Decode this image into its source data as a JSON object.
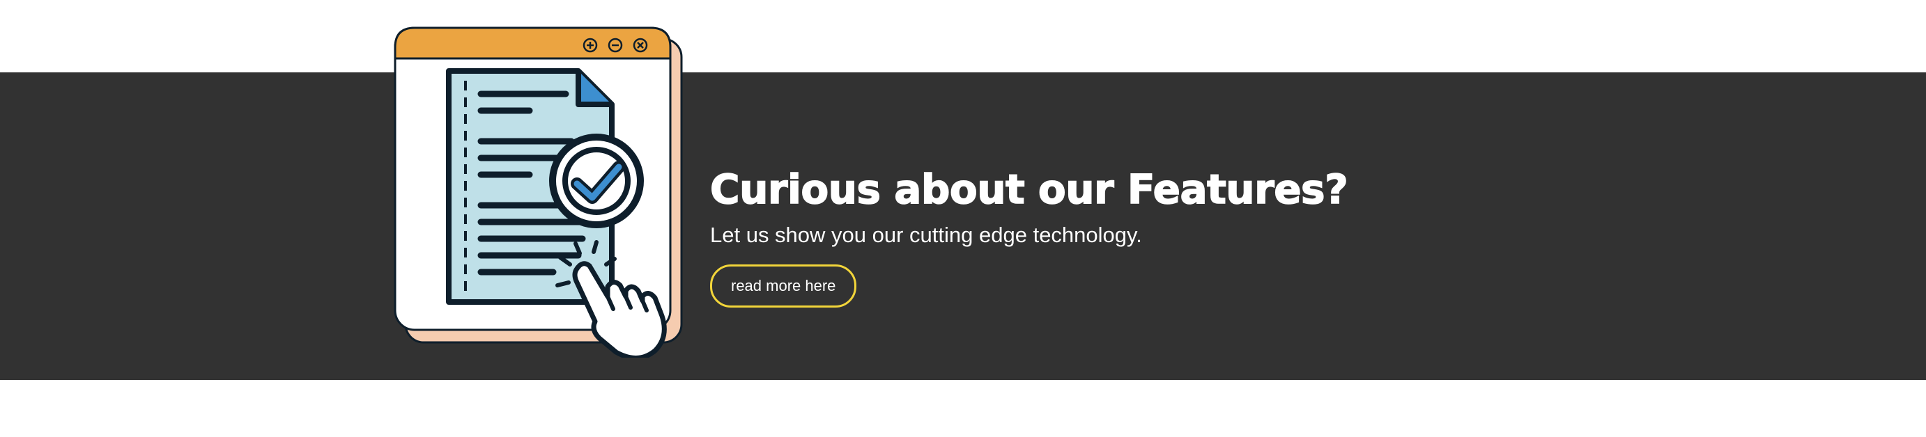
{
  "banner": {
    "title": "Curious about our Features?",
    "subtitle": "Let us show you our cutting edge technology.",
    "cta_label": "read more here"
  },
  "illustration": {
    "window_controls": [
      "plus-circle-icon",
      "minus-circle-icon",
      "close-circle-icon"
    ],
    "document_icon": "document-icon",
    "badge_icon": "check-badge-icon",
    "pointer_icon": "hand-pointer-icon"
  },
  "colors": {
    "band_background": "#323232",
    "page_background": "#ffffff",
    "window_titlebar": "#eba441",
    "window_shadow": "#f6ccb0",
    "document_fill": "#bfe0e8",
    "check_blue": "#3d8fd0",
    "outline": "#0e1e2b",
    "cta_border": "#f2d53a"
  }
}
